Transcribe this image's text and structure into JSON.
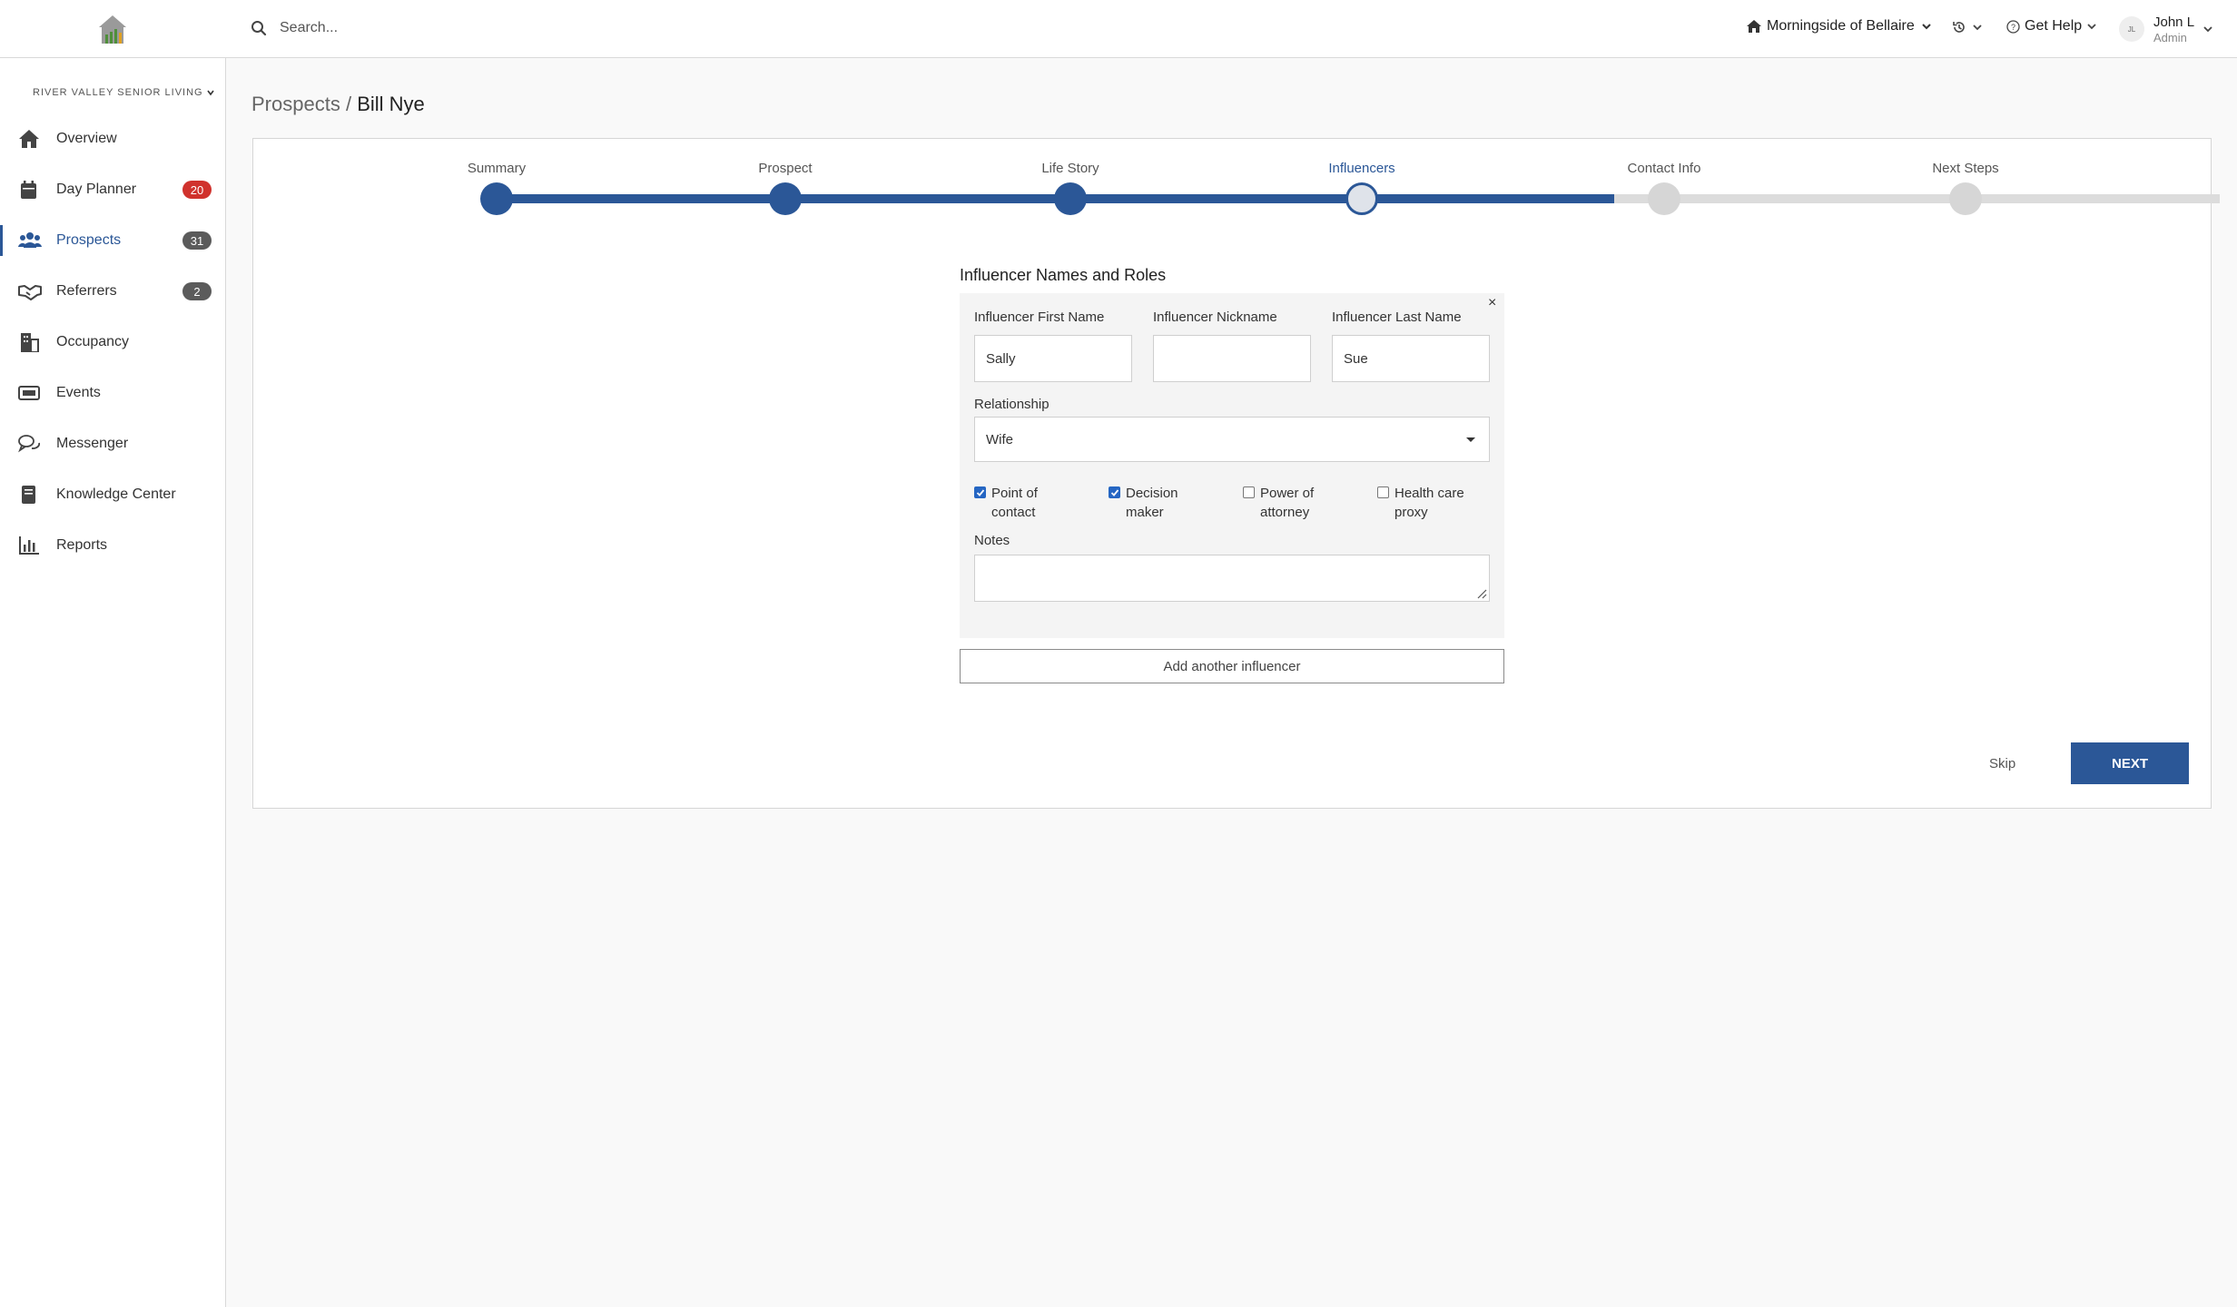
{
  "header": {
    "logo_icon": "house-logo-icon",
    "search": {
      "placeholder": "Search...",
      "icon": "search-icon"
    },
    "community": {
      "label": "Morningside of Bellaire",
      "icon": "home-icon"
    },
    "history_icon": "history-icon",
    "help": {
      "label": "Get Help",
      "icon": "help-circle-icon"
    },
    "user": {
      "initials": "JL",
      "name": "John L",
      "role": "Admin"
    }
  },
  "sidebar": {
    "org_name": "RIVER VALLEY SENIOR LIVING",
    "items": [
      {
        "label": "Overview",
        "icon": "home-icon",
        "badge": null,
        "active": false
      },
      {
        "label": "Day Planner",
        "icon": "calendar-icon",
        "badge": "20",
        "badge_color": "#d0322d",
        "active": false
      },
      {
        "label": "Prospects",
        "icon": "people-icon",
        "badge": "31",
        "badge_color": "#5b5b5b",
        "active": true
      },
      {
        "label": "Referrers",
        "icon": "handshake-icon",
        "badge": "2",
        "badge_color": "#5b5b5b",
        "active": false
      },
      {
        "label": "Occupancy",
        "icon": "building-icon",
        "badge": null,
        "active": false
      },
      {
        "label": "Events",
        "icon": "ticket-icon",
        "badge": null,
        "active": false
      },
      {
        "label": "Messenger",
        "icon": "chat-icon",
        "badge": null,
        "active": false
      },
      {
        "label": "Knowledge Center",
        "icon": "book-icon",
        "badge": null,
        "active": false
      },
      {
        "label": "Reports",
        "icon": "bar-chart-icon",
        "badge": null,
        "active": false
      }
    ]
  },
  "breadcrumb": {
    "parent": "Prospects",
    "separator": "/",
    "current": "Bill Nye"
  },
  "stepper": {
    "steps": [
      "Summary",
      "Prospect",
      "Life Story",
      "Influencers",
      "Contact Info",
      "Next Steps"
    ],
    "current_index": 3
  },
  "form": {
    "title": "Influencer Names and Roles",
    "remove_label": "×",
    "first_name": {
      "label": "Influencer First Name",
      "value": "Sally"
    },
    "nickname": {
      "label": "Influencer Nickname",
      "value": ""
    },
    "last_name": {
      "label": "Influencer Last Name",
      "value": "Sue"
    },
    "relationship": {
      "label": "Relationship",
      "value": "Wife"
    },
    "roles": [
      {
        "label": "Point of contact",
        "checked": true
      },
      {
        "label": "Decision maker",
        "checked": true
      },
      {
        "label": "Power of attorney",
        "checked": false
      },
      {
        "label": "Health care proxy",
        "checked": false
      }
    ],
    "notes": {
      "label": "Notes",
      "value": ""
    },
    "add_button": "Add another influencer"
  },
  "actions": {
    "skip": "Skip",
    "next": "NEXT"
  },
  "colors": {
    "primary": "#2b5797",
    "badge_red": "#d0322d",
    "badge_gray": "#5b5b5b",
    "track_inactive": "#dcdcdc"
  }
}
